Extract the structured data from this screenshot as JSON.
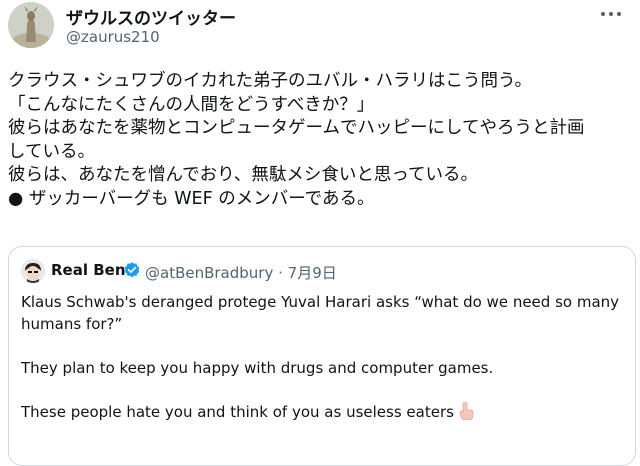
{
  "author": {
    "display_name": "ザウルスのツイッター",
    "handle": "@zaurus210",
    "avatar_icon": "deer-avatar-icon"
  },
  "more_icon": "more-options-icon",
  "tweet_lines": [
    "クラウス・シュワブのイカれた弟子のユバル・ハラリはこう問う。",
    "「こんなにたくさんの人間をどうすべきか？」",
    "彼らはあなたを薬物とコンピュータゲームでハッピーにしてやろうと計画",
    "している。",
    "彼らは、あなたを憎んでおり、無駄メシ食いと思っている。",
    "● ザッカーバーグも WEF のメンバーである。"
  ],
  "quoted": {
    "display_name": "Real Ben",
    "verified_icon": "verified-badge-icon",
    "meta": "@atBenBradbury · 7月9日",
    "paragraph_1": "Klaus Schwab's deranged protege Yuval Harari asks “what do we need so many humans for?”",
    "paragraph_2": "They plan to keep you happy with drugs and computer games.",
    "paragraph_3": "These people hate you and think of you as useless eaters",
    "emoji_icon": "pointing-down-hand-icon",
    "accent_color": "#1d9bf0"
  }
}
